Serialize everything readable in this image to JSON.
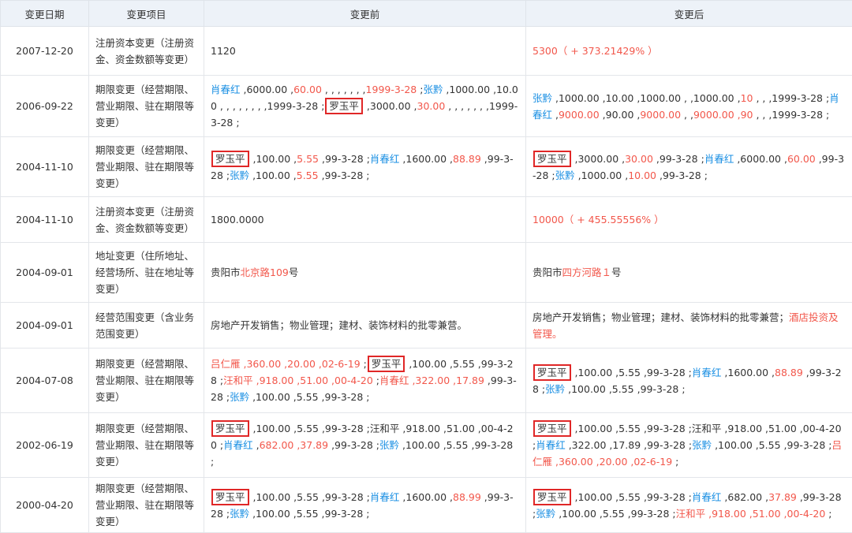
{
  "colors": {
    "header_bg": "#edf2f8",
    "blue": "#1a8fe3",
    "red": "#f2574b",
    "box": "#e02727",
    "text": "#333333"
  },
  "headers": {
    "date": "变更日期",
    "item": "变更项目",
    "before": "变更前",
    "after": "变更后"
  },
  "rows": [
    {
      "date": "2007-12-20",
      "item": "注册资本变更（注册资金、资金数额等变更）",
      "before": [
        {
          "t": "1120",
          "c": "normal"
        }
      ],
      "after": [
        {
          "t": "5300（ + 373.21429% ）",
          "c": "red"
        }
      ]
    },
    {
      "date": "2006-09-22",
      "item": "期限变更（经营期限、营业期限、驻在期限等变更）",
      "before": [
        {
          "t": "肖春红",
          "c": "blue"
        },
        {
          "t": " ,6000.00 ,",
          "c": "normal"
        },
        {
          "t": "60.00",
          "c": "red"
        },
        {
          "t": " , , , , , , ,",
          "c": "normal"
        },
        {
          "t": "1999-3-28",
          "c": "red"
        },
        {
          "t": " ;",
          "c": "normal"
        },
        {
          "t": "张黔",
          "c": "blue"
        },
        {
          "t": " ,1000.00 ,10.00 , , , , , , , ,1999-3-28 ;",
          "c": "normal"
        },
        {
          "t": "罗玉平",
          "c": "boxed"
        },
        {
          "t": " ,3000.00 ,",
          "c": "normal"
        },
        {
          "t": "30.00",
          "c": "red"
        },
        {
          "t": " , , , , , , ,1999-3-28 ;",
          "c": "normal"
        }
      ],
      "after": [
        {
          "t": "张黔",
          "c": "blue"
        },
        {
          "t": " ,1000.00 ,10.00 ,1000.00 , ,1000.00 ,",
          "c": "normal"
        },
        {
          "t": "10",
          "c": "red"
        },
        {
          "t": " , , ,1999-3-28 ;",
          "c": "normal"
        },
        {
          "t": "肖春红",
          "c": "blue"
        },
        {
          "t": " ,",
          "c": "normal"
        },
        {
          "t": "9000.00",
          "c": "red"
        },
        {
          "t": " ,90.00 ,",
          "c": "normal"
        },
        {
          "t": "9000.00",
          "c": "red"
        },
        {
          "t": " , ,",
          "c": "normal"
        },
        {
          "t": "9000.00 ,90",
          "c": "red"
        },
        {
          "t": " , , ,1999-3-28 ;",
          "c": "normal"
        }
      ]
    },
    {
      "date": "2004-11-10",
      "item": "期限变更（经营期限、营业期限、驻在期限等变更）",
      "before": [
        {
          "t": "罗玉平",
          "c": "boxed"
        },
        {
          "t": " ,100.00 ,",
          "c": "normal"
        },
        {
          "t": "5.55",
          "c": "red"
        },
        {
          "t": " ,99-3-28 ;",
          "c": "normal"
        },
        {
          "t": "肖春红",
          "c": "blue"
        },
        {
          "t": " ,1600.00 ,",
          "c": "normal"
        },
        {
          "t": "88.89",
          "c": "red"
        },
        {
          "t": " ,99-3-28 ;",
          "c": "normal"
        },
        {
          "t": "张黔",
          "c": "blue"
        },
        {
          "t": " ,100.00 ,",
          "c": "normal"
        },
        {
          "t": "5.55",
          "c": "red"
        },
        {
          "t": " ,99-3-28 ;",
          "c": "normal"
        }
      ],
      "after": [
        {
          "t": "罗玉平",
          "c": "boxed"
        },
        {
          "t": " ,3000.00 ,",
          "c": "normal"
        },
        {
          "t": "30.00",
          "c": "red"
        },
        {
          "t": " ,99-3-28 ;",
          "c": "normal"
        },
        {
          "t": "肖春红",
          "c": "blue"
        },
        {
          "t": " ,6000.00 ,",
          "c": "normal"
        },
        {
          "t": "60.00",
          "c": "red"
        },
        {
          "t": " ,99-3-28 ;",
          "c": "normal"
        },
        {
          "t": "张黔",
          "c": "blue"
        },
        {
          "t": " ,1000.00 ,",
          "c": "normal"
        },
        {
          "t": "10.00",
          "c": "red"
        },
        {
          "t": " ,99-3-28 ;",
          "c": "normal"
        }
      ]
    },
    {
      "date": "2004-11-10",
      "item": "注册资本变更（注册资金、资金数额等变更）",
      "before": [
        {
          "t": "1800.0000",
          "c": "normal"
        }
      ],
      "after": [
        {
          "t": "10000（ + 455.55556% ）",
          "c": "red"
        }
      ]
    },
    {
      "date": "2004-09-01",
      "item": "地址变更（住所地址、经营场所、驻在地址等变更）",
      "before": [
        {
          "t": "贵阳市",
          "c": "normal"
        },
        {
          "t": "北京路109",
          "c": "red"
        },
        {
          "t": "号",
          "c": "normal"
        }
      ],
      "after": [
        {
          "t": "贵阳市",
          "c": "normal"
        },
        {
          "t": "四方河路１",
          "c": "red"
        },
        {
          "t": "号",
          "c": "normal"
        }
      ]
    },
    {
      "date": "2004-09-01",
      "item": "经营范围变更（含业务范围变更）",
      "before": [
        {
          "t": "房地产开发销售；物业管理；建材、装饰材料的批零兼营。",
          "c": "normal"
        }
      ],
      "after": [
        {
          "t": "房地产开发销售；物业管理；建材、装饰材料的批零兼营；",
          "c": "normal"
        },
        {
          "t": "酒店投资及管理。",
          "c": "red"
        }
      ]
    },
    {
      "date": "2004-07-08",
      "item": "期限变更（经营期限、营业期限、驻在期限等变更）",
      "before": [
        {
          "t": "吕仁雁 ,360.00 ,20.00 ,02-6-19",
          "c": "red"
        },
        {
          "t": " ;",
          "c": "normal"
        },
        {
          "t": "罗玉平",
          "c": "boxed"
        },
        {
          "t": " ,100.00 ,5.55 ,99-3-28 ;",
          "c": "normal"
        },
        {
          "t": "汪和平 ,918.00 ,51.00 ,00-4-20",
          "c": "red"
        },
        {
          "t": " ;",
          "c": "normal"
        },
        {
          "t": "肖春红 ,322.00 ,17.89",
          "c": "red"
        },
        {
          "t": " ,99-3-28 ;",
          "c": "normal"
        },
        {
          "t": "张黔",
          "c": "blue"
        },
        {
          "t": " ,100.00 ,5.55 ,99-3-28 ;",
          "c": "normal"
        }
      ],
      "after": [
        {
          "t": "罗玉平",
          "c": "boxed"
        },
        {
          "t": " ,100.00 ,5.55 ,99-3-28 ;",
          "c": "normal"
        },
        {
          "t": "肖春红",
          "c": "blue"
        },
        {
          "t": " ,1600.00 ,",
          "c": "normal"
        },
        {
          "t": "88.89",
          "c": "red"
        },
        {
          "t": " ,99-3-28 ;",
          "c": "normal"
        },
        {
          "t": "张黔",
          "c": "blue"
        },
        {
          "t": " ,100.00 ,5.55 ,99-3-28 ;",
          "c": "normal"
        }
      ]
    },
    {
      "date": "2002-06-19",
      "item": "期限变更（经营期限、营业期限、驻在期限等变更）",
      "before": [
        {
          "t": "罗玉平",
          "c": "boxed"
        },
        {
          "t": " ,100.00 ,5.55 ,99-3-28 ;汪和平 ,918.00 ,51.00 ,00-4-20 ;",
          "c": "normal"
        },
        {
          "t": "肖春红",
          "c": "blue"
        },
        {
          "t": " ,",
          "c": "normal"
        },
        {
          "t": "682.00 ,37.89",
          "c": "red"
        },
        {
          "t": " ,99-3-28 ;",
          "c": "normal"
        },
        {
          "t": "张黔",
          "c": "blue"
        },
        {
          "t": " ,100.00 ,5.55 ,99-3-28 ;",
          "c": "normal"
        }
      ],
      "after": [
        {
          "t": "罗玉平",
          "c": "boxed"
        },
        {
          "t": " ,100.00 ,5.55 ,99-3-28 ;汪和平 ,918.00 ,51.00 ,00-4-20 ;",
          "c": "normal"
        },
        {
          "t": "肖春红",
          "c": "blue"
        },
        {
          "t": " ,322.00 ,17.89 ,99-3-28 ;",
          "c": "normal"
        },
        {
          "t": "张黔",
          "c": "blue"
        },
        {
          "t": " ,100.00 ,5.55 ,99-3-28 ;",
          "c": "normal"
        },
        {
          "t": "吕仁雁 ,360.00 ,20.00 ,02-6-19",
          "c": "red"
        },
        {
          "t": " ;",
          "c": "normal"
        }
      ]
    },
    {
      "date": "2000-04-20",
      "item": "期限变更（经营期限、营业期限、驻在期限等变更）",
      "before": [
        {
          "t": "罗玉平",
          "c": "boxed"
        },
        {
          "t": " ,100.00 ,5.55 ,99-3-28 ;",
          "c": "normal"
        },
        {
          "t": "肖春红",
          "c": "blue"
        },
        {
          "t": " ,1600.00 ,",
          "c": "normal"
        },
        {
          "t": "88.99",
          "c": "red"
        },
        {
          "t": " ,99-3-28 ;",
          "c": "normal"
        },
        {
          "t": "张黔",
          "c": "blue"
        },
        {
          "t": " ,100.00 ,5.55 ,99-3-28 ;",
          "c": "normal"
        }
      ],
      "after": [
        {
          "t": "罗玉平",
          "c": "boxed"
        },
        {
          "t": " ,100.00 ,5.55 ,99-3-28 ;",
          "c": "normal"
        },
        {
          "t": "肖春红",
          "c": "blue"
        },
        {
          "t": " ,682.00 ,",
          "c": "normal"
        },
        {
          "t": "37.89",
          "c": "red"
        },
        {
          "t": " ,99-3-28 ;",
          "c": "normal"
        },
        {
          "t": "张黔",
          "c": "blue"
        },
        {
          "t": " ,100.00 ,5.55 ,99-3-28 ;",
          "c": "normal"
        },
        {
          "t": "汪和平 ,918.00 ,51.00 ,00-4-20",
          "c": "red"
        },
        {
          "t": " ;",
          "c": "normal"
        }
      ]
    }
  ]
}
